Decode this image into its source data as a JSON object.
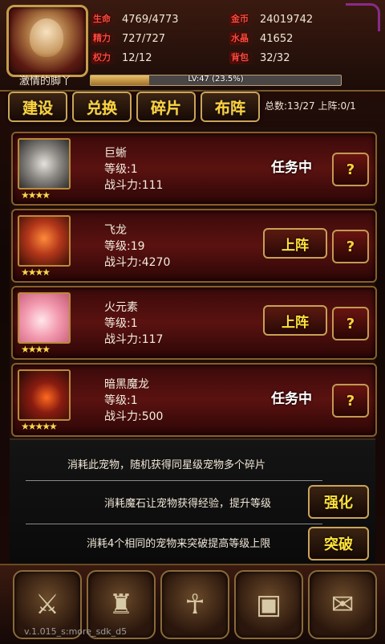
{
  "player": {
    "name": "激情的脚丫",
    "level_text": "LV:47 (23.5%)",
    "xp_percent": 23.5
  },
  "stats": [
    {
      "label": "生命",
      "value": "4769/4773"
    },
    {
      "label": "精力",
      "value": "727/727"
    },
    {
      "label": "权力",
      "value": "12/12"
    },
    {
      "label": "金币",
      "value": "24019742"
    },
    {
      "label": "水晶",
      "value": "41652"
    },
    {
      "label": "背包",
      "value": "32/32"
    }
  ],
  "tabs": [
    "建设",
    "兑换",
    "碎片",
    "布阵"
  ],
  "summary": "总数:13/27 上阵:0/1",
  "pets": [
    {
      "name": "巨蜥",
      "level": "等级:1",
      "power": "战斗力:111",
      "stars": "★★★★",
      "status": "任务中",
      "deploy": ""
    },
    {
      "name": "飞龙",
      "level": "等级:19",
      "power": "战斗力:4270",
      "stars": "★★★★",
      "status": "",
      "deploy": "上阵"
    },
    {
      "name": "火元素",
      "level": "等级:1",
      "power": "战斗力:117",
      "stars": "★★★★",
      "status": "",
      "deploy": "上阵"
    },
    {
      "name": "暗黑魔龙",
      "level": "等级:1",
      "power": "战斗力:500",
      "stars": "★★★★★",
      "status": "任务中",
      "deploy": ""
    }
  ],
  "help_label": "?",
  "info": {
    "line1": "消耗此宠物，随机获得同星级宠物多个碎片",
    "line2": "消耗魔石让宠物获得经验，提升等级",
    "line3": "消耗4个相同的宠物来突破提高等级上限",
    "strengthen": "强化",
    "breakthrough": "突破"
  },
  "version": "v.1.015_s:more_sdk_d5",
  "colors": {
    "accent_gold": "#ffd23a",
    "panel_red": "#5a1210",
    "stat_red": "#ff4a3c"
  },
  "icons": [
    "shield-swords-icon",
    "armor-icon",
    "pharaoh-icon",
    "chest-icon",
    "spellbook-icon"
  ]
}
